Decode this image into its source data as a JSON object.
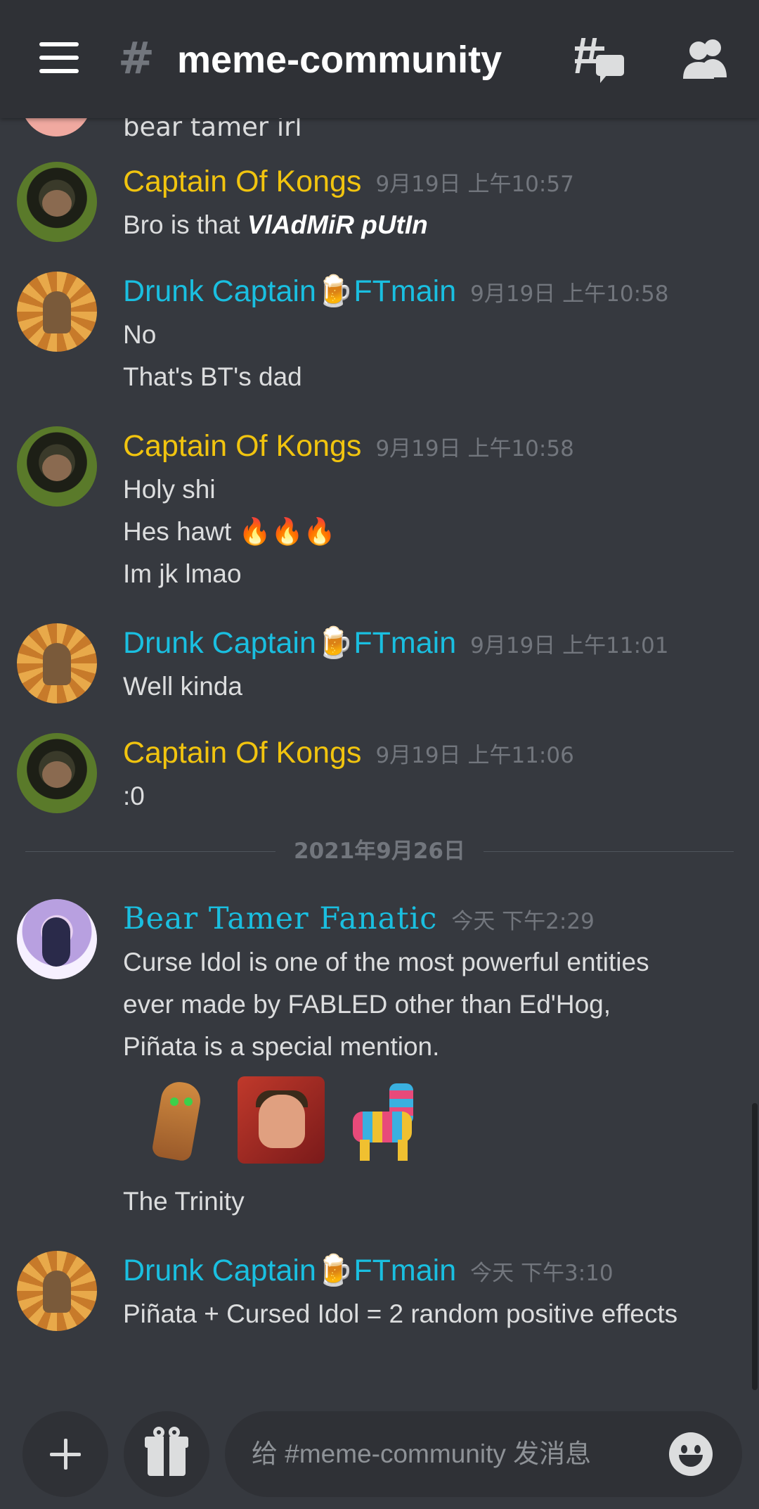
{
  "header": {
    "channel_hash": "#",
    "channel_name": "meme-community",
    "menu_icon": "hamburger-menu-icon",
    "threads_icon": "threads-icon",
    "members_icon": "members-icon"
  },
  "partial_message": {
    "text": "bear tamer irl"
  },
  "messages": [
    {
      "user": "Captain Of Kongs",
      "time": "9月19日 上午10:57",
      "lines": [
        "Bro is that",
        "VlAdMiR pUtIn"
      ]
    },
    {
      "user": "Drunk Captain🍺FTmain",
      "time": "9月19日 上午10:58",
      "lines": [
        "No",
        "That's BT's dad"
      ]
    },
    {
      "user": "Captain Of Kongs",
      "time": "9月19日 上午10:58",
      "lines": [
        "Holy shi",
        "Hes hawt 🔥🔥🔥",
        "Im jk lmao"
      ]
    },
    {
      "user": "Drunk Captain🍺FTmain",
      "time": "9月19日 上午11:01",
      "lines": [
        "Well kinda"
      ]
    },
    {
      "user": "Captain Of Kongs",
      "time": "9月19日 上午11:06",
      "lines": [
        ":0"
      ]
    },
    {
      "user": "Bear Tamer Fanatic",
      "time": "今天 下午2:29",
      "lines": [
        "Curse Idol is one of the most powerful entities",
        "ever made by FABLED other than Ed'Hog,",
        "Piñata is a special mention.",
        "The Trinity"
      ],
      "stickers": [
        "cursed-idol-sticker",
        "barbarian-sticker",
        "pinata-sticker"
      ]
    },
    {
      "user": "Drunk Captain🍺FTmain",
      "time": "今天 下午3:10",
      "lines": [
        "Piñata + Cursed Idol = 2 random positive effects"
      ]
    }
  ],
  "date_divider": "2021年9月26日",
  "composer": {
    "placeholder": "给 #meme-community 发消息",
    "add_icon": "plus-icon",
    "gift_icon": "gift-icon",
    "emoji_icon": "emoji-icon"
  },
  "colors": {
    "background": "#36393f",
    "topbar": "#2f3136",
    "kong_name": "#f1c40f",
    "drunk_name": "#1abfe0",
    "timestamp": "#72767d"
  }
}
